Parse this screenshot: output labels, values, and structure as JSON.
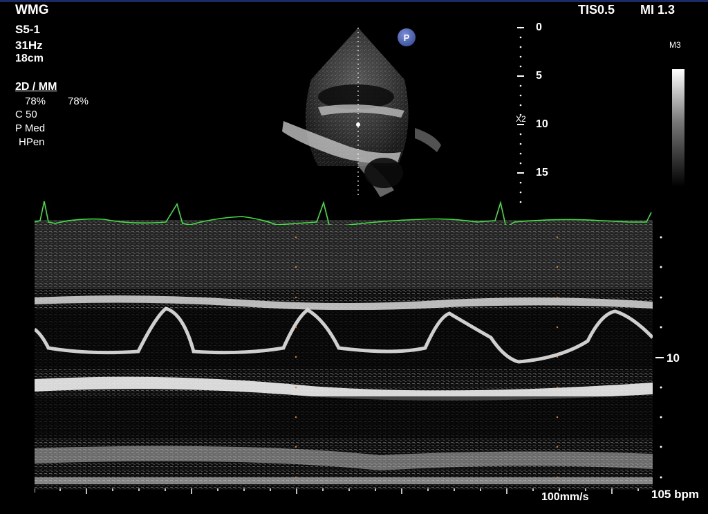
{
  "header": {
    "site": "WMG",
    "probe": "S5-1",
    "frame_rate": "31Hz",
    "depth": "18cm",
    "tis": "TIS0.5",
    "mi": "MI 1.3",
    "map": "M3"
  },
  "settings": {
    "mode": "2D / MM",
    "gain_2d": "78%",
    "gain_mm": "78%",
    "compression": "C 50",
    "power": "P Med",
    "harmonic": "HPen"
  },
  "probe_badge": "P",
  "depth_scale": {
    "labels": [
      "0",
      "5",
      "10",
      "15"
    ],
    "focus_label": "X2"
  },
  "mmode_scale": {
    "label": "10"
  },
  "footer": {
    "sweep_speed": "100mm/s",
    "heart_rate": "105 bpm"
  },
  "colors": {
    "ecg": "#44e044",
    "focus": "#3a8a4a",
    "caliper": "#e08020",
    "badge": "#3a4f9e"
  }
}
